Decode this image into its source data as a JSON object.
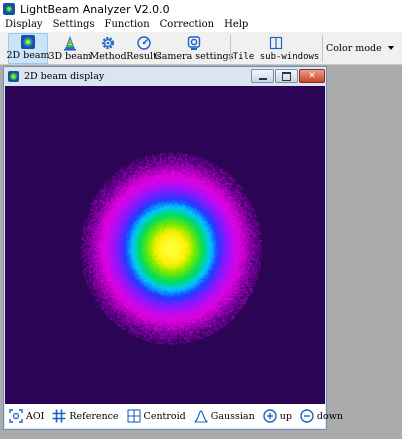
{
  "app": {
    "title": "LightBeam Analyzer V2.0.0"
  },
  "menu": [
    "Display",
    "Settings",
    "Function",
    "Correction",
    "Help"
  ],
  "toolbar": {
    "beam2d": "2D beam",
    "beam3d": "3D beam",
    "method": "Method",
    "results": "Results",
    "camera": "Camera settings",
    "tile": "Tile sub-windows",
    "color_mode": "Color mode"
  },
  "subwindow": {
    "title": "2D beam display",
    "background_color": "#2c0455"
  },
  "bottom_tools": {
    "aoi": "AOI",
    "reference": "Reference",
    "centroid": "Centroid",
    "gaussian": "Gaussian",
    "zoom_up": "up",
    "zoom_down": "down"
  },
  "colors": {
    "accent": "#1c64c8",
    "toolbar_active": "#cce4f7"
  }
}
